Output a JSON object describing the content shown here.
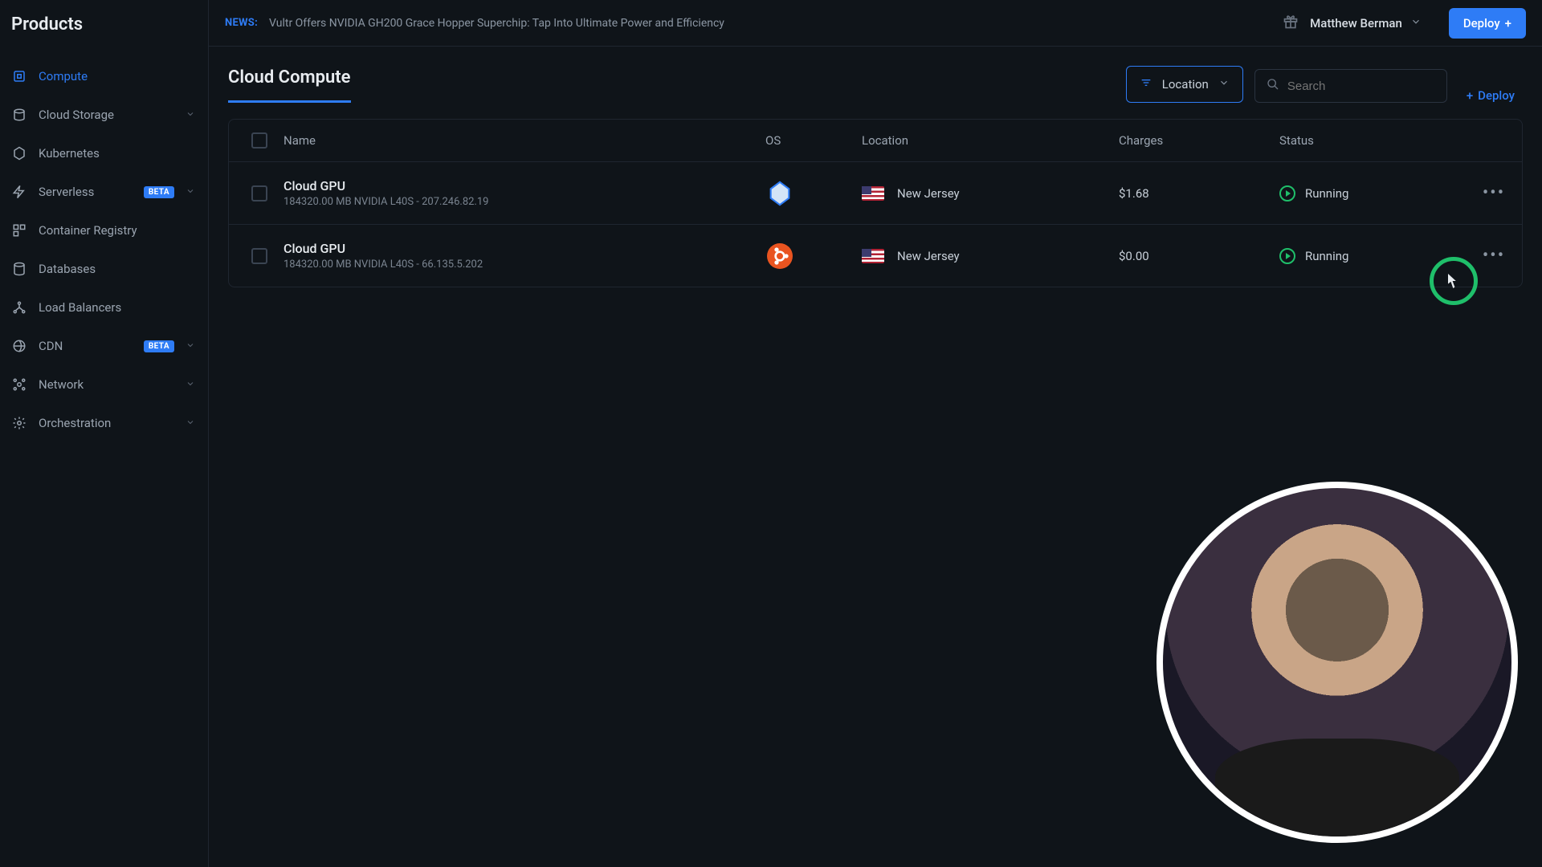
{
  "sidebar": {
    "title": "Products",
    "items": [
      {
        "label": "Compute",
        "active": true,
        "expandable": false
      },
      {
        "label": "Cloud Storage",
        "expandable": true
      },
      {
        "label": "Kubernetes",
        "expandable": false
      },
      {
        "label": "Serverless",
        "badge": "BETA",
        "expandable": true
      },
      {
        "label": "Container Registry",
        "expandable": false
      },
      {
        "label": "Databases",
        "expandable": false
      },
      {
        "label": "Load Balancers",
        "expandable": false
      },
      {
        "label": "CDN",
        "badge": "BETA",
        "expandable": true
      },
      {
        "label": "Network",
        "expandable": true
      },
      {
        "label": "Orchestration",
        "expandable": true
      }
    ]
  },
  "topbar": {
    "news_label": "NEWS:",
    "news_text": "Vultr Offers NVIDIA GH200 Grace Hopper Superchip: Tap Into Ultimate Power and Efficiency",
    "user_name": "Matthew Berman",
    "deploy_label": "Deploy"
  },
  "toolbar": {
    "page_tab": "Cloud Compute",
    "location_label": "Location",
    "search_placeholder": "Search",
    "deploy_small_label": "Deploy"
  },
  "table": {
    "headers": {
      "name": "Name",
      "os": "OS",
      "location": "Location",
      "charges": "Charges",
      "status": "Status"
    },
    "rows": [
      {
        "name": "Cloud GPU",
        "sub": "184320.00 MB NVIDIA L40S - 207.246.82.19",
        "os": "custom",
        "location": "New Jersey",
        "charges": "$1.68",
        "status": "Running"
      },
      {
        "name": "Cloud GPU",
        "sub": "184320.00 MB NVIDIA L40S - 66.135.5.202",
        "os": "ubuntu",
        "location": "New Jersey",
        "charges": "$0.00",
        "status": "Running"
      }
    ]
  }
}
